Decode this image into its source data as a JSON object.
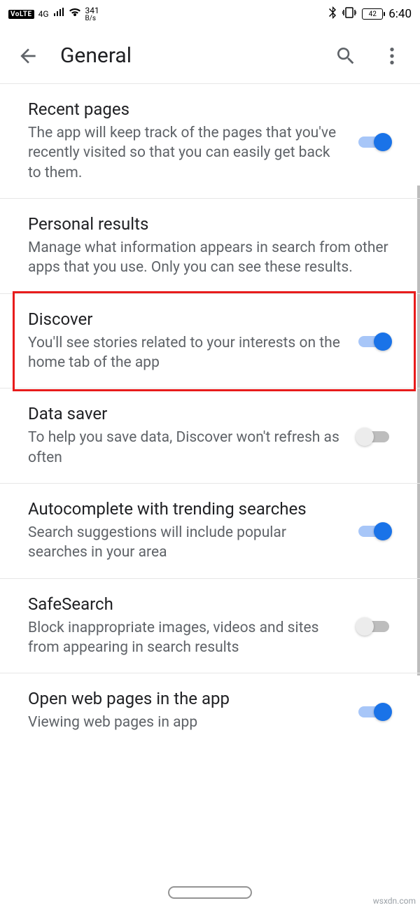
{
  "status_bar": {
    "volte": "VoLTE",
    "network": "4G",
    "rate_value": "341",
    "rate_unit": "B/s",
    "battery": "42",
    "time": "6:40"
  },
  "app_bar": {
    "title": "General"
  },
  "settings": [
    {
      "title": "Recent pages",
      "desc": "The app will keep track of the pages that you've recently visited so that you can easily get back to them.",
      "toggle": "on"
    },
    {
      "title": "Personal results",
      "desc": "Manage what information appears in search from other apps that you use. Only you can see these results.",
      "toggle": null
    },
    {
      "title": "Discover",
      "desc": "You'll see stories related to your interests on the home tab of the app",
      "toggle": "on",
      "highlight": true
    },
    {
      "title": "Data saver",
      "desc": "To help you save data, Discover won't refresh as often",
      "toggle": "off"
    },
    {
      "title": "Autocomplete with trending searches",
      "desc": "Search suggestions will include popular searches in your area",
      "toggle": "on"
    },
    {
      "title": "SafeSearch",
      "desc": "Block inappropriate images, videos and sites from appearing in search results",
      "toggle": "off"
    },
    {
      "title": "Open web pages in the app",
      "desc": "Viewing web pages in app",
      "toggle": "on"
    }
  ],
  "watermark": "wsxdn.com"
}
